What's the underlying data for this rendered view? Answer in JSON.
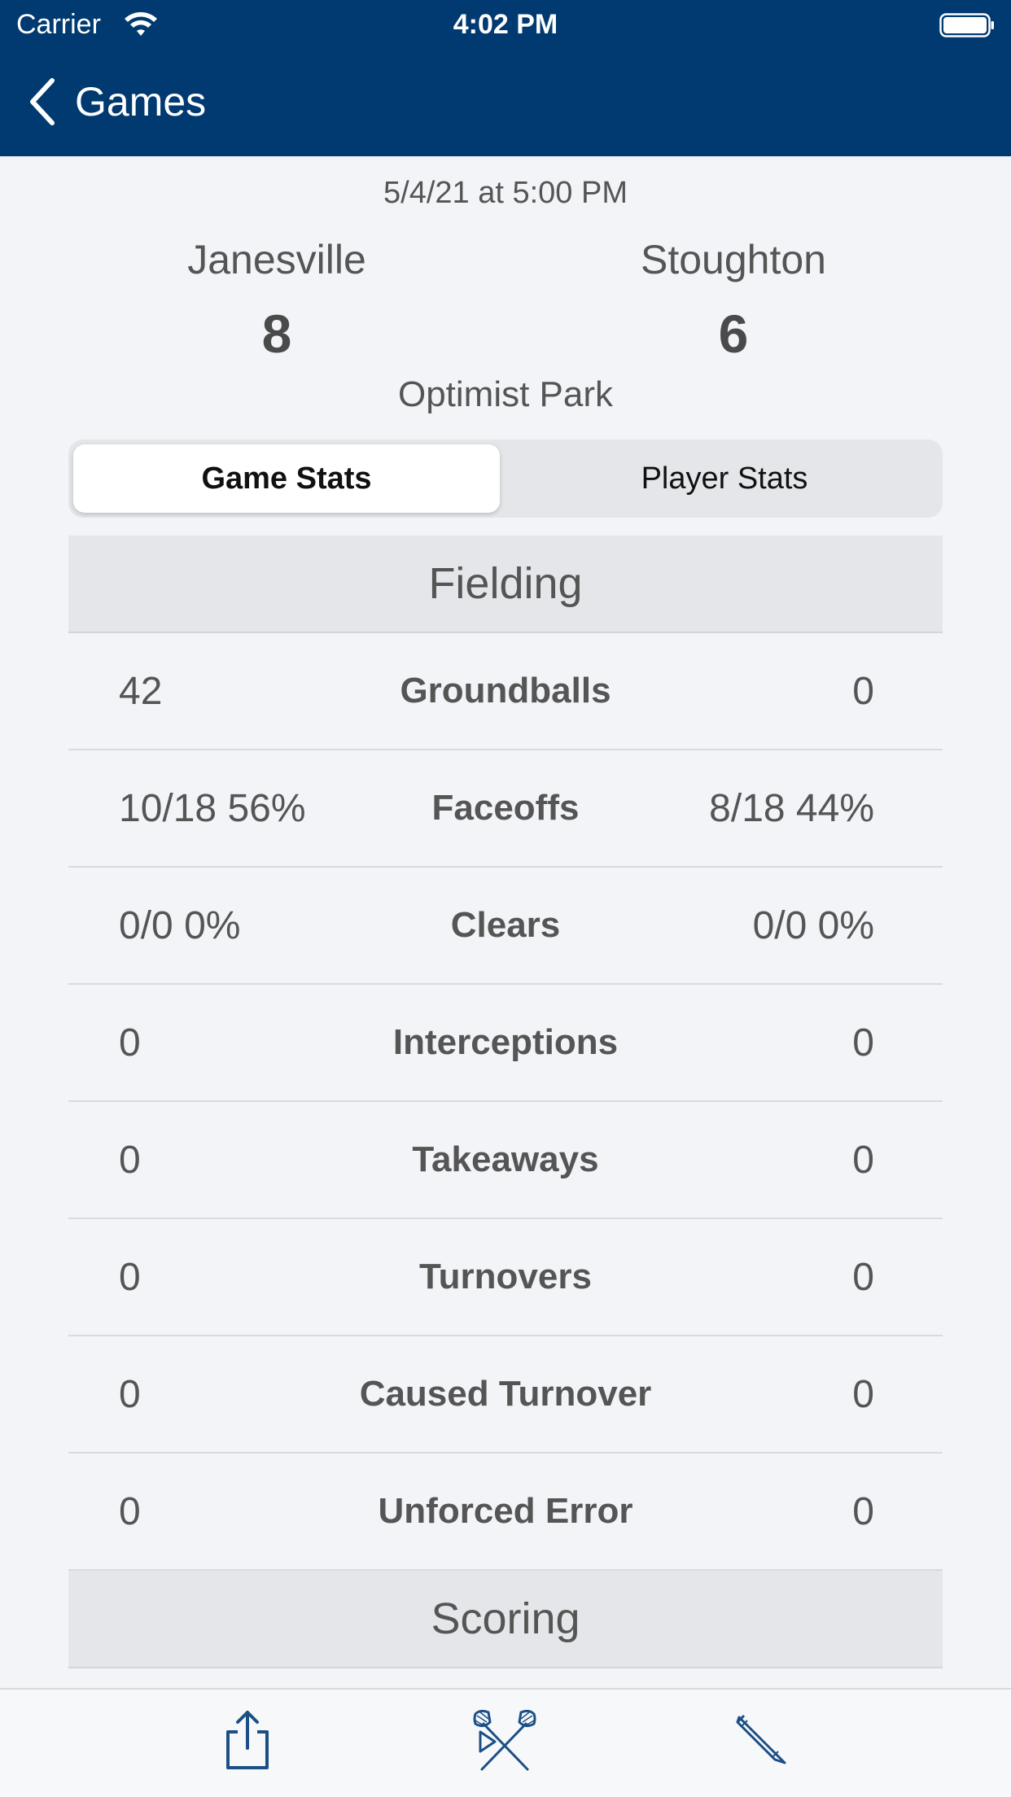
{
  "status_bar": {
    "carrier": "Carrier",
    "time": "4:02 PM"
  },
  "nav": {
    "back_label": "Games"
  },
  "game": {
    "datetime": "5/4/21 at 5:00 PM",
    "home_team": "Janesville",
    "away_team": "Stoughton",
    "home_score": "8",
    "away_score": "6",
    "venue": "Optimist Park"
  },
  "tabs": [
    {
      "label": "Game Stats",
      "selected": true
    },
    {
      "label": "Player Stats",
      "selected": false
    }
  ],
  "sections": {
    "fielding": "Fielding",
    "scoring": "Scoring"
  },
  "rows": [
    {
      "left": "42",
      "label": "Groundballs",
      "right": "0"
    },
    {
      "left": "10/18 56%",
      "label": "Faceoffs",
      "right": "8/18 44%"
    },
    {
      "left": "0/0 0%",
      "label": "Clears",
      "right": "0/0 0%"
    },
    {
      "left": "0",
      "label": "Interceptions",
      "right": "0"
    },
    {
      "left": "0",
      "label": "Takeaways",
      "right": "0"
    },
    {
      "left": "0",
      "label": "Turnovers",
      "right": "0"
    },
    {
      "left": "0",
      "label": "Caused Turnover",
      "right": "0"
    },
    {
      "left": "0",
      "label": "Unforced Error",
      "right": "0"
    }
  ],
  "toolbar": {
    "icons": [
      "share-icon",
      "lacrosse-sticks-icon",
      "pencil-icon"
    ]
  },
  "colors": {
    "nav_background": "#003a70",
    "toolbar_icon": "#1b4f86",
    "page_background": "#f2f4f7"
  }
}
